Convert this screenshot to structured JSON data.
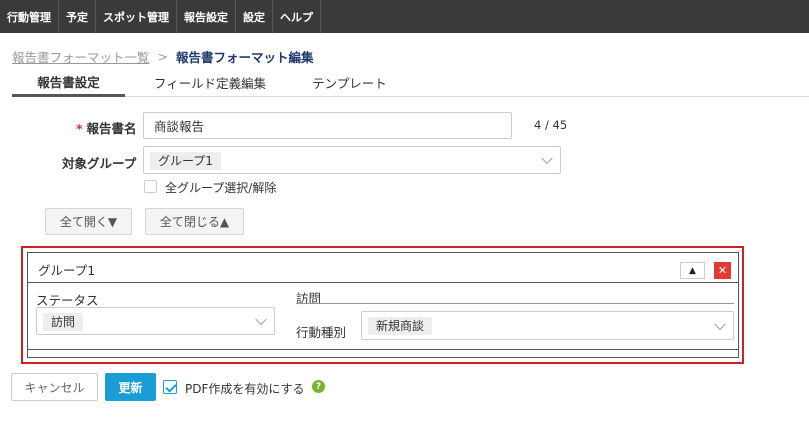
{
  "nav": {
    "items": [
      "行動管理",
      "予定",
      "スポット管理",
      "報告設定",
      "設定",
      "ヘルプ"
    ]
  },
  "breadcrumb": {
    "parent": "報告書フォーマット一覧",
    "separator": ">",
    "current": "報告書フォーマット編集"
  },
  "tabs": [
    {
      "label": "報告書設定",
      "active": true
    },
    {
      "label": "フィールド定義編集",
      "active": false
    },
    {
      "label": "テンプレート",
      "active": false
    }
  ],
  "form": {
    "required_mark": "*",
    "name_label": "報告書名",
    "name_value": "商談報告",
    "name_counter": "4 / 45",
    "group_label": "対象グループ",
    "group_selected": "グループ1",
    "select_all_label": "全グループ選択/解除",
    "expand_all": "全て開く▼",
    "collapse_all": "全て閉じる▲"
  },
  "group_panel": {
    "title": "グループ1",
    "move_up": "▲",
    "close": "✕",
    "status_label": "ステータス",
    "status_value": "訪問",
    "section_label": "訪問",
    "action_type_label": "行動種別",
    "action_type_value": "新規商談"
  },
  "actions": {
    "cancel": "キャンセル",
    "save": "更新",
    "pdf_label": "PDF作成を有効にする",
    "pdf_enabled": true,
    "help": "?"
  },
  "colors": {
    "nav_bg": "#3a3a3a",
    "accent_blue": "#1a9cd6",
    "highlight_red": "#cc2222",
    "required_red": "#e0302a",
    "help_green": "#7ab32e"
  }
}
